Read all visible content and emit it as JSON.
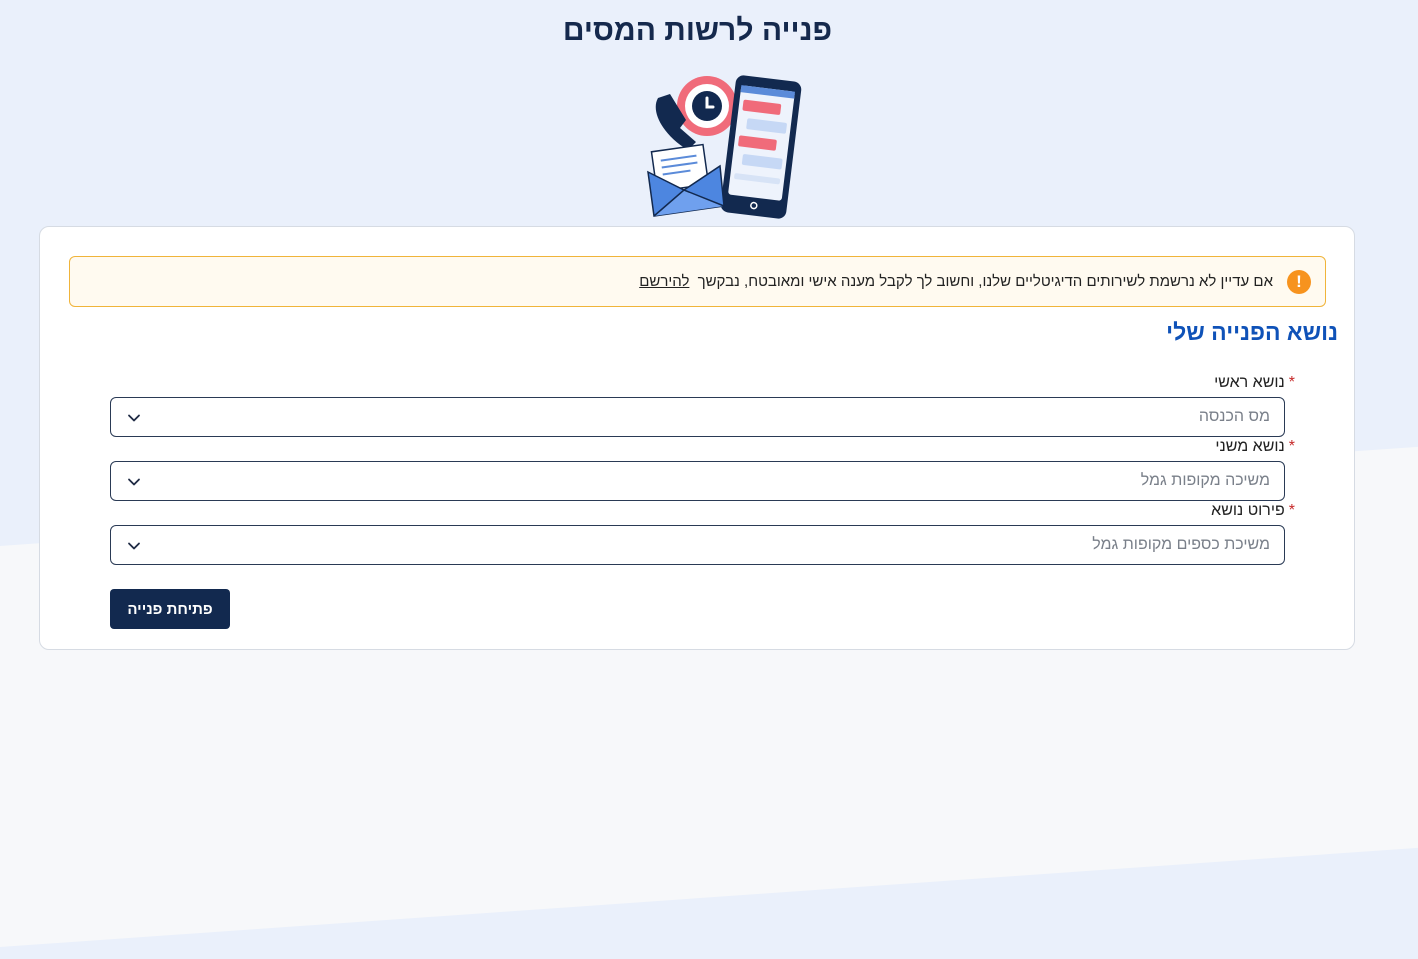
{
  "page": {
    "title": "פנייה לרשות המסים"
  },
  "alert": {
    "text": "אם עדיין לא נרשמת לשירותים הדיגיטליים שלנו, וחשוב לך לקבל מענה אישי ומאובטח, נבקשך",
    "link": "להירשם",
    "icon": "exclamation-icon",
    "icon_glyph": "!",
    "color": "#f7931e"
  },
  "form": {
    "section_title": "נושא הפנייה שלי",
    "required_mark": "*",
    "fields": [
      {
        "label": "נושא ראשי",
        "value": "מס הכנסה"
      },
      {
        "label": "נושא משני",
        "value": "משיכה מקופות גמל"
      },
      {
        "label": "פירוט נושא",
        "value": "משיכת כספים מקופות גמל"
      }
    ],
    "submit_label": "פתיחת פנייה"
  },
  "colors": {
    "background": "#eaf0fb",
    "primary": "#12294f",
    "accent": "#0f52b8",
    "alert_border": "#f0b43a"
  }
}
